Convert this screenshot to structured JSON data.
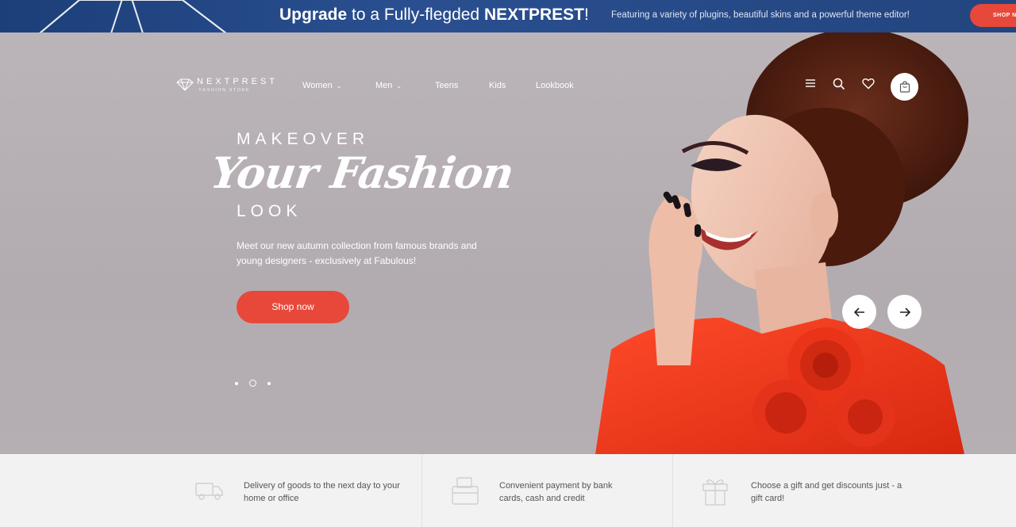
{
  "promo": {
    "title_bold_1": "Upgrade",
    "title_middle": " to a Fully-flegded ",
    "title_bold_2": "NEXTPREST",
    "title_end": "!",
    "subtitle": "Featuring a variety of plugins, beautiful skins and a powerful theme editor!",
    "button_label": "SHOP NOW"
  },
  "logo": {
    "name": "NEXTPREST",
    "tagline": "FASHION STORE"
  },
  "nav": {
    "items": [
      {
        "label": "Women",
        "has_dropdown": true
      },
      {
        "label": "Men",
        "has_dropdown": true
      },
      {
        "label": "Teens",
        "has_dropdown": false
      },
      {
        "label": "Kids",
        "has_dropdown": false
      },
      {
        "label": "Lookbook",
        "has_dropdown": false
      }
    ]
  },
  "header_icons": [
    "menu-icon",
    "search-icon",
    "heart-icon",
    "shopping-bag-icon"
  ],
  "hero": {
    "kicker": "MAKEOVER",
    "headline": "Your Fashion",
    "kicker2": "LOOK",
    "description": "Meet our new autumn collection from famous brands and young designers - exclusively at Fabulous!",
    "button_label": "Shop now",
    "slide_count": 3,
    "active_slide": 2
  },
  "features": [
    {
      "icon": "truck-icon",
      "text": "Delivery of goods to the next day to your home or office"
    },
    {
      "icon": "wallet-icon",
      "text": "Convenient payment by bank cards, cash and credit"
    },
    {
      "icon": "gift-icon",
      "text": "Choose a gift and get discounts just - a gift card!"
    }
  ],
  "colors": {
    "accent": "#e8483a",
    "banner": "#23457f",
    "hero_bg": "#b6b0b4"
  }
}
